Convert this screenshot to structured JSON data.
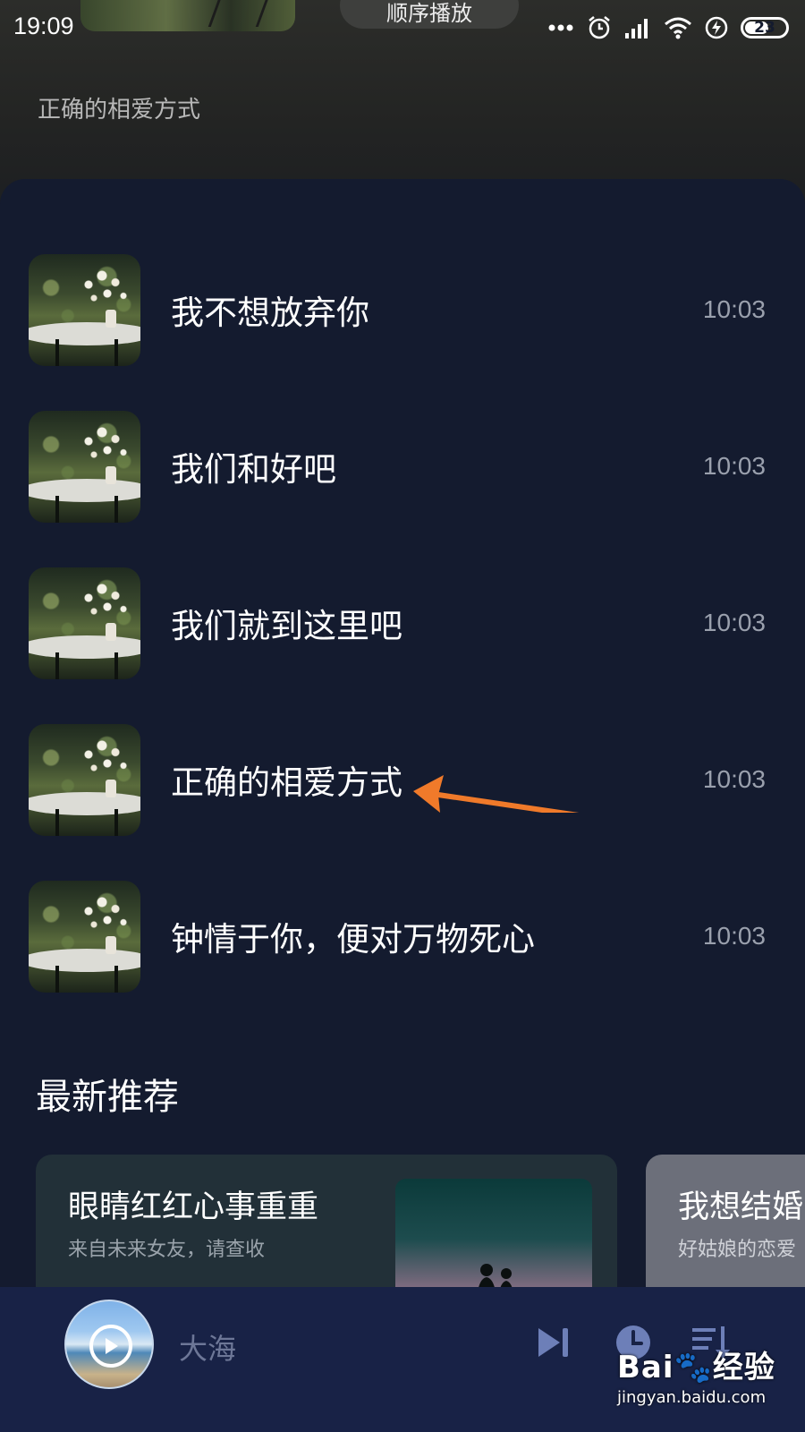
{
  "status_bar": {
    "time": "19:09",
    "battery": "23"
  },
  "header": {
    "play_order": "顺序播放",
    "current_song_title": "正确的相爱方式"
  },
  "songs": [
    {
      "title": "我不想放弃你",
      "duration": "10:03"
    },
    {
      "title": "我们和好吧",
      "duration": "10:03"
    },
    {
      "title": "我们就到这里吧",
      "duration": "10:03"
    },
    {
      "title": "正确的相爱方式",
      "duration": "10:03"
    },
    {
      "title": "钟情于你，便对万物死心",
      "duration": "10:03"
    }
  ],
  "recommend": {
    "section_title": "最新推荐",
    "cards": [
      {
        "title": "眼睛红红心事重重",
        "subtitle": "来自未来女友，请查收"
      },
      {
        "title": "我想结婚",
        "subtitle": "好姑娘的恋爱"
      }
    ]
  },
  "player": {
    "song": "大海"
  },
  "watermark": {
    "logo": "Bai🐾经验",
    "url": "jingyan.baidu.com"
  },
  "colors": {
    "background": "#141b2f",
    "player_bar": "#182246",
    "annotation_arrow": "#f07a2a"
  }
}
